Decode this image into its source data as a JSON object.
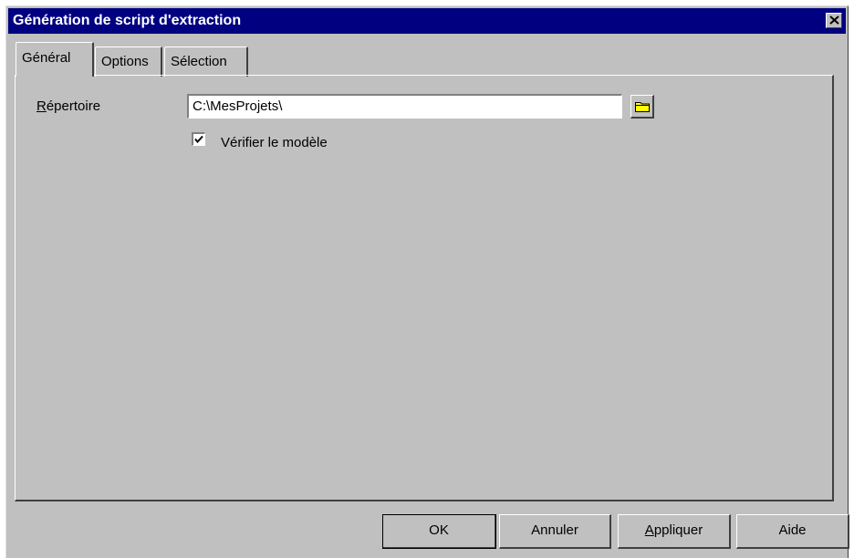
{
  "dialog": {
    "title": "Génération de script d'extraction"
  },
  "tabs": [
    {
      "label": "Général",
      "active": true
    },
    {
      "label": "Options",
      "active": false
    },
    {
      "label": "Sélection",
      "active": false
    }
  ],
  "general": {
    "directory_label_first": "R",
    "directory_label_rest": "épertoire",
    "directory_value": "C:\\MesProjets\\",
    "check_model_label": "Vérifier le modèle",
    "check_model_checked": true
  },
  "buttons": {
    "ok": "OK",
    "cancel": "Annuler",
    "apply_first": "A",
    "apply_rest": "ppliquer",
    "help": "Aide"
  },
  "icons": {
    "close": "close-icon",
    "browse": "folder-icon",
    "check": "checkmark-icon"
  },
  "colors": {
    "titlebar": "#000080",
    "dialog_face": "#c0c0c0",
    "folder_icon": "#ffff00"
  }
}
